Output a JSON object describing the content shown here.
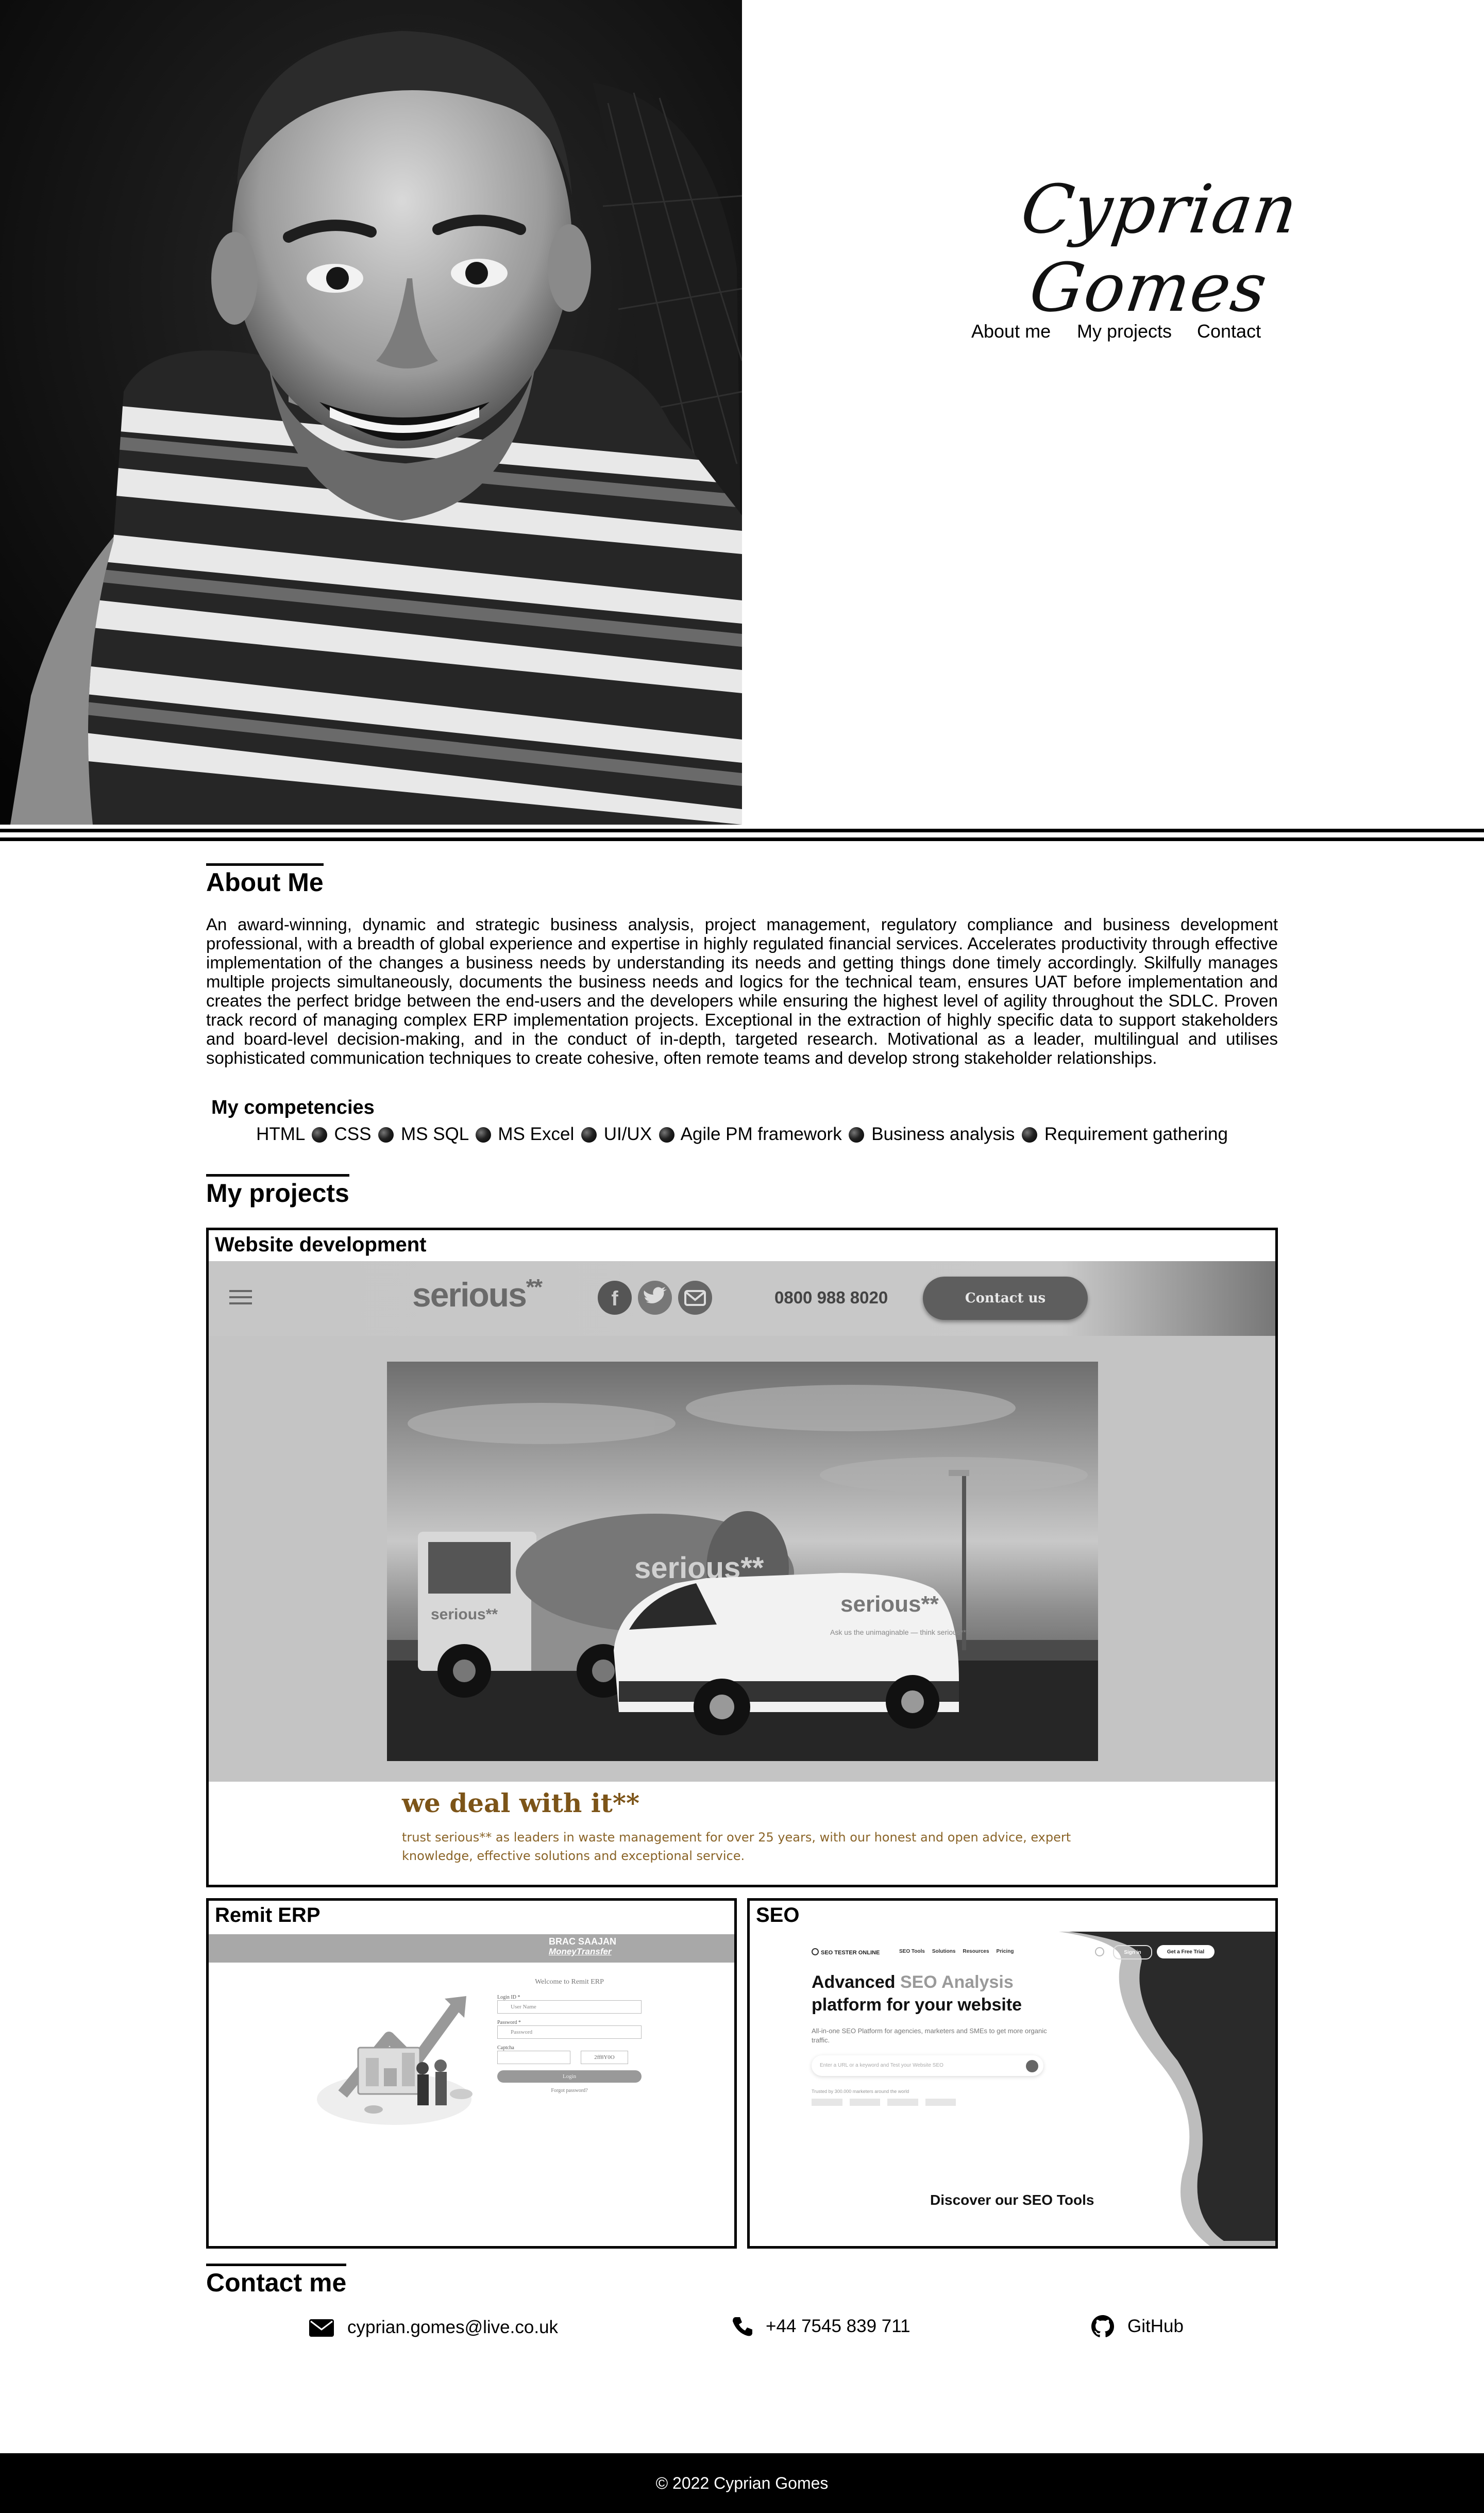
{
  "hero": {
    "signature": "Cyprian Gomes",
    "nav": {
      "about": "About me",
      "projects": "My projects",
      "contact": "Contact"
    }
  },
  "about": {
    "title": "About Me",
    "text": "An award-winning, dynamic and strategic business analysis, project management, regulatory compliance and business development professional, with a breadth of global experience and expertise in highly regulated financial services. Accelerates productivity through effective implementation of the changes a business needs by understanding its needs and getting things done timely accordingly. Skilfully manages multiple projects simultaneously, documents the business needs and logics for the technical team, ensures UAT before implementation and creates the perfect bridge between the end-users and the developers while ensuring the highest level of agility throughout the SDLC. Proven track record of managing complex ERP implementation projects. Exceptional in the extraction of highly specific data to support stakeholders and board-level decision-making, and in the conduct of in-depth, targeted research. Motivational as a leader, multilingual and utilises sophisticated communication techniques to create cohesive, often remote teams and develop strong stakeholder relationships."
  },
  "competencies": {
    "title": "My competencies",
    "items": [
      "HTML",
      "CSS",
      "MS SQL",
      "MS Excel",
      "UI/UX",
      "Agile PM framework",
      "Business analysis",
      "Requirement gathering"
    ]
  },
  "projects": {
    "title": "My projects",
    "web": {
      "title": "Website development",
      "logo": "serious",
      "logo_stars": "**",
      "phone": "0800 988 8020",
      "cta": "Contact us",
      "truck_text": "serious**",
      "van_text": "serious**",
      "van_tagline": "Ask us the unimaginable — think serious**",
      "headline": "we deal with it**",
      "subtext_1": "trust serious** as leaders in waste management for over 25 years, with our honest and open advice, expert",
      "subtext_2": "knowledge, effective solutions and exceptional service."
    },
    "erp": {
      "title": "Remit ERP",
      "brand_1": "BRAC SAAJAN",
      "brand_2": "MoneyTransfer",
      "welcome": "Welcome to Remit ERP",
      "login_label": "Login ID *",
      "login_placeholder": "User Name",
      "password_label": "Password *",
      "password_placeholder": "Password",
      "captcha_label": "Captcha",
      "captcha_value": "2ff8Y0O",
      "login_button": "Login",
      "forgot": "Forgot password?"
    },
    "seo": {
      "title": "SEO",
      "brand": "SEO TESTER ONLINE",
      "nav": [
        "SEO Tools",
        "Solutions",
        "Resources",
        "Pricing"
      ],
      "signin": "Sign in",
      "trial": "Get a Free Trial",
      "headline_1": "Advanced",
      "headline_highlight": "SEO Analysis",
      "headline_2": "platform for your website",
      "subtext": "All-in-one SEO Platform for agencies, marketers and SMEs to get more organic traffic.",
      "search_placeholder": "Enter a URL or a keyword and Test your Website SEO",
      "trusted": "Trusted by 300.000 marketers around the world",
      "discover": "Discover our SEO Tools"
    }
  },
  "contact": {
    "title": "Contact me",
    "email": "cyprian.gomes@live.co.uk",
    "phone": "+44 7545 839 711",
    "github": "GitHub"
  },
  "footer": {
    "text": "© 2022 Cyprian Gomes"
  }
}
